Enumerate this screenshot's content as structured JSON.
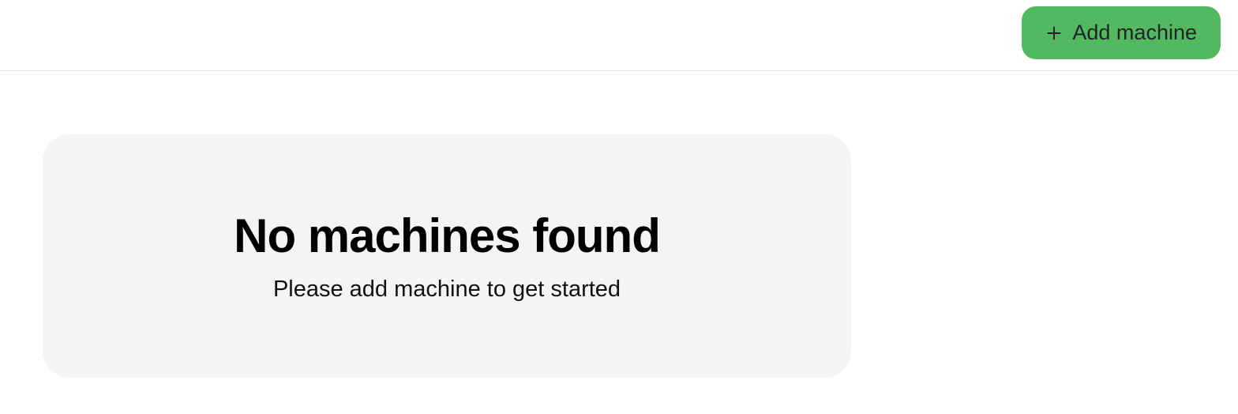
{
  "header": {
    "add_machine_label": "Add machine"
  },
  "empty_state": {
    "title": "No machines found",
    "subtitle": "Please add machine to get started"
  }
}
